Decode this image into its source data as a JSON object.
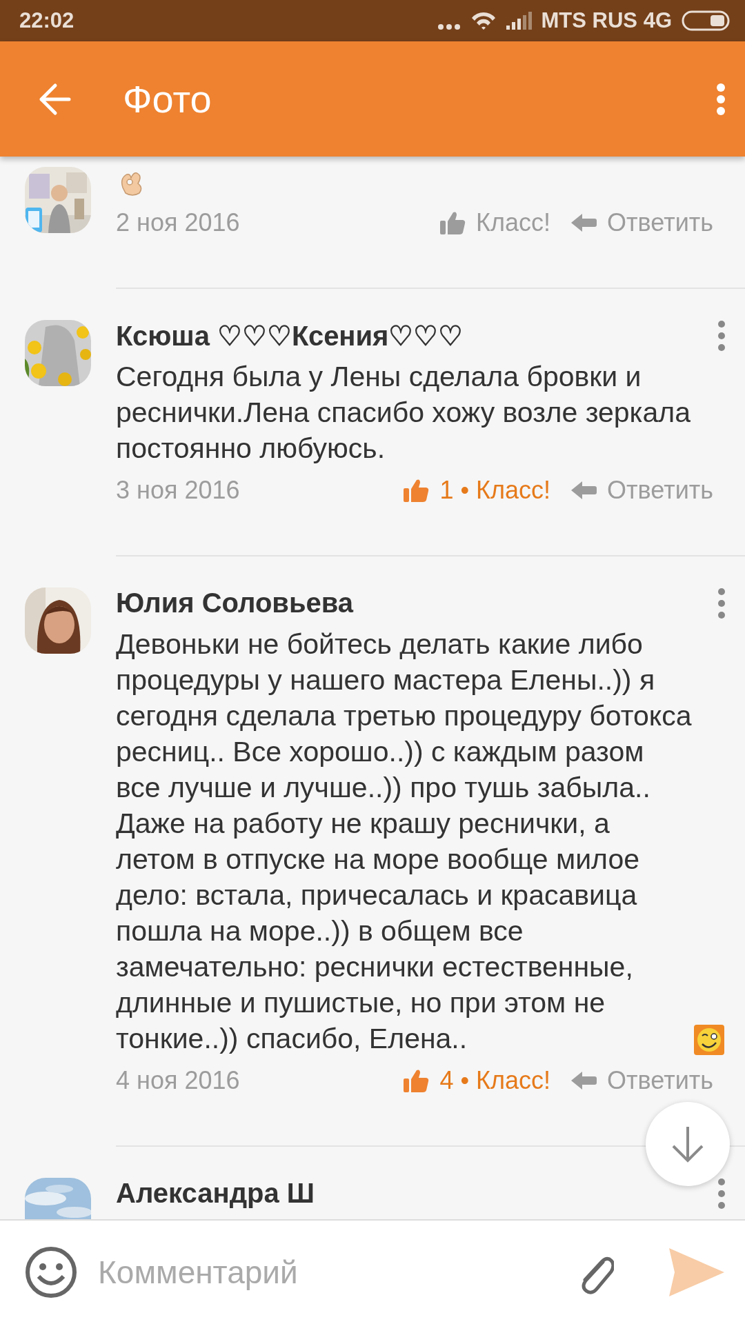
{
  "status_bar": {
    "time": "22:02",
    "carrier": "MTS RUS 4G"
  },
  "app_bar": {
    "title": "Фото"
  },
  "comments": [
    {
      "emoji": true,
      "date": "2 ноя 2016",
      "like": {
        "label": "Класс!",
        "liked": false
      },
      "reply": "Ответить"
    },
    {
      "name": "Ксюша ♡♡♡Ксения♡♡♡",
      "text": "Сегодня была у Лены сделала бровки и реснички.Лена спасибо хожу возле зеркала постоянно любуюсь.",
      "date": "3 ноя 2016",
      "like": {
        "label": "1 • Класс!",
        "liked": true
      },
      "reply": "Ответить"
    },
    {
      "name": "Юлия Соловьева",
      "text": "Девоньки не бойтесь делать какие либо процедуры у нашего мастера Елены..)) я сегодня сделала третью процедуру ботокса ресниц.. Все хорошо..)) с каждым разом все лучше и лучше..)) про тушь забыла.. Даже на работу не крашу реснички, а летом в отпуске на море вообще милое дело: встала, причесалась и красавица пошла на море..)) в общем все замечательно: реснички естественные, длинные и пушистые, но при этом не тонкие..)) спасибо, Елена..",
      "emoji": true,
      "date": "4 ноя 2016",
      "like": {
        "label": "4 • Класс!",
        "liked": true
      },
      "reply": "Ответить"
    },
    {
      "name": "Александра Ш"
    }
  ],
  "composer": {
    "placeholder": "Комментарий",
    "send_enabled": false
  }
}
